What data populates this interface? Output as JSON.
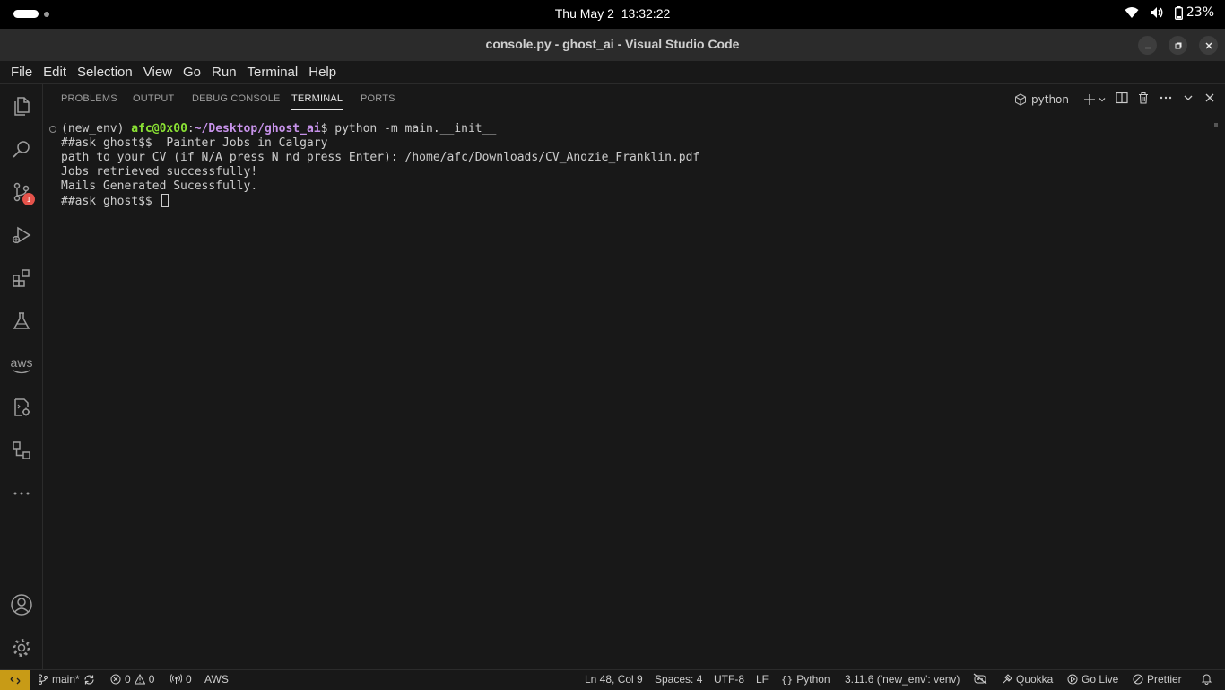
{
  "topbar": {
    "date": "Thu May 2",
    "time": "13:32:22",
    "battery": "23%"
  },
  "window": {
    "title": "console.py - ghost_ai - Visual Studio Code"
  },
  "menu": [
    "File",
    "Edit",
    "Selection",
    "View",
    "Go",
    "Run",
    "Terminal",
    "Help"
  ],
  "activity": {
    "scm_badge": "1",
    "aws_label": "aws"
  },
  "panel": {
    "tabs": [
      "PROBLEMS",
      "OUTPUT",
      "DEBUG CONSOLE",
      "TERMINAL",
      "PORTS"
    ],
    "active_tab": "TERMINAL",
    "profile": "python"
  },
  "terminal": {
    "env": "(new_env) ",
    "user": "afc@0x00",
    "colon": ":",
    "path": "~/Desktop/ghost_ai",
    "command": "$ python -m main.__init__",
    "lines": [
      "##ask ghost$$  Painter Jobs in Calgary",
      "path to your CV (if N/A press N nd press Enter): /home/afc/Downloads/CV_Anozie_Franklin.pdf",
      "Jobs retrieved successfully!",
      "Mails Generated Sucessfully."
    ],
    "prompt": "##ask ghost$$ "
  },
  "status": {
    "branch": "main*",
    "errors": "0",
    "warnings": "0",
    "ports": "0",
    "aws": "AWS",
    "position": "Ln 48, Col 9",
    "spaces": "Spaces: 4",
    "encoding": "UTF-8",
    "eol": "LF",
    "language": "Python",
    "interpreter": "3.11.6 ('new_env': venv)",
    "quokka": "Quokka",
    "golive": "Go Live",
    "prettier": "Prettier"
  }
}
